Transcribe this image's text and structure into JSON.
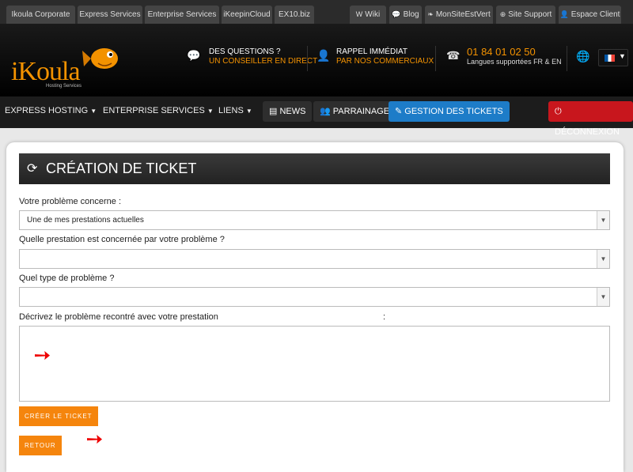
{
  "top_tabs": {
    "left": [
      "Ikoula Corporate",
      "Express Services",
      "Enterprise Services",
      "iKeepinCloud",
      "EX10.biz"
    ],
    "right": [
      {
        "icon": "wiki-icon",
        "glyph": "W",
        "label": "Wiki"
      },
      {
        "icon": "comment-icon",
        "glyph": "💬",
        "label": "Blog"
      },
      {
        "icon": "leaf-icon",
        "glyph": "❧",
        "label": "MonSiteEstVert"
      },
      {
        "icon": "support-icon",
        "glyph": "⊕",
        "label": "Site Support"
      },
      {
        "icon": "user-icon",
        "glyph": "👤",
        "label": "Espace Client"
      }
    ]
  },
  "header": {
    "logo_text": "iKoula",
    "logo_sub": "Hosting Services",
    "questions_line1": "DES QUESTIONS ?",
    "questions_line2": "UN CONSEILLER EN DIRECT",
    "callback_line1": "RAPPEL IMMÉDIAT",
    "callback_line2": "PAR NOS COMMERCIAUX",
    "phone": "01 84 01 02 50",
    "languages": "Langues supportées FR & EN"
  },
  "nav": {
    "express": "EXPRESS HOSTING",
    "enterprise": "ENTERPRISE SERVICES",
    "liens": "LIENS",
    "news": "NEWS",
    "parrainage": "PARRAINAGE",
    "tickets": "GESTION DES TICKETS",
    "logout": "DÉCONNEXION"
  },
  "form": {
    "title": "CRÉATION DE TICKET",
    "q1_label": "Votre problème concerne :",
    "q1_value": "Une de mes prestations actuelles",
    "q2_label": "Quelle prestation est concernée par votre problème ?",
    "q2_value": "",
    "q3_label": "Quel type de problème ?",
    "q3_value": "",
    "desc_label": "Décrivez le problème recontré avec votre prestation",
    "desc_colon": ":",
    "desc_value": "",
    "submit_label": "CRÉER LE TICKET",
    "back_label": "RETOUR"
  }
}
